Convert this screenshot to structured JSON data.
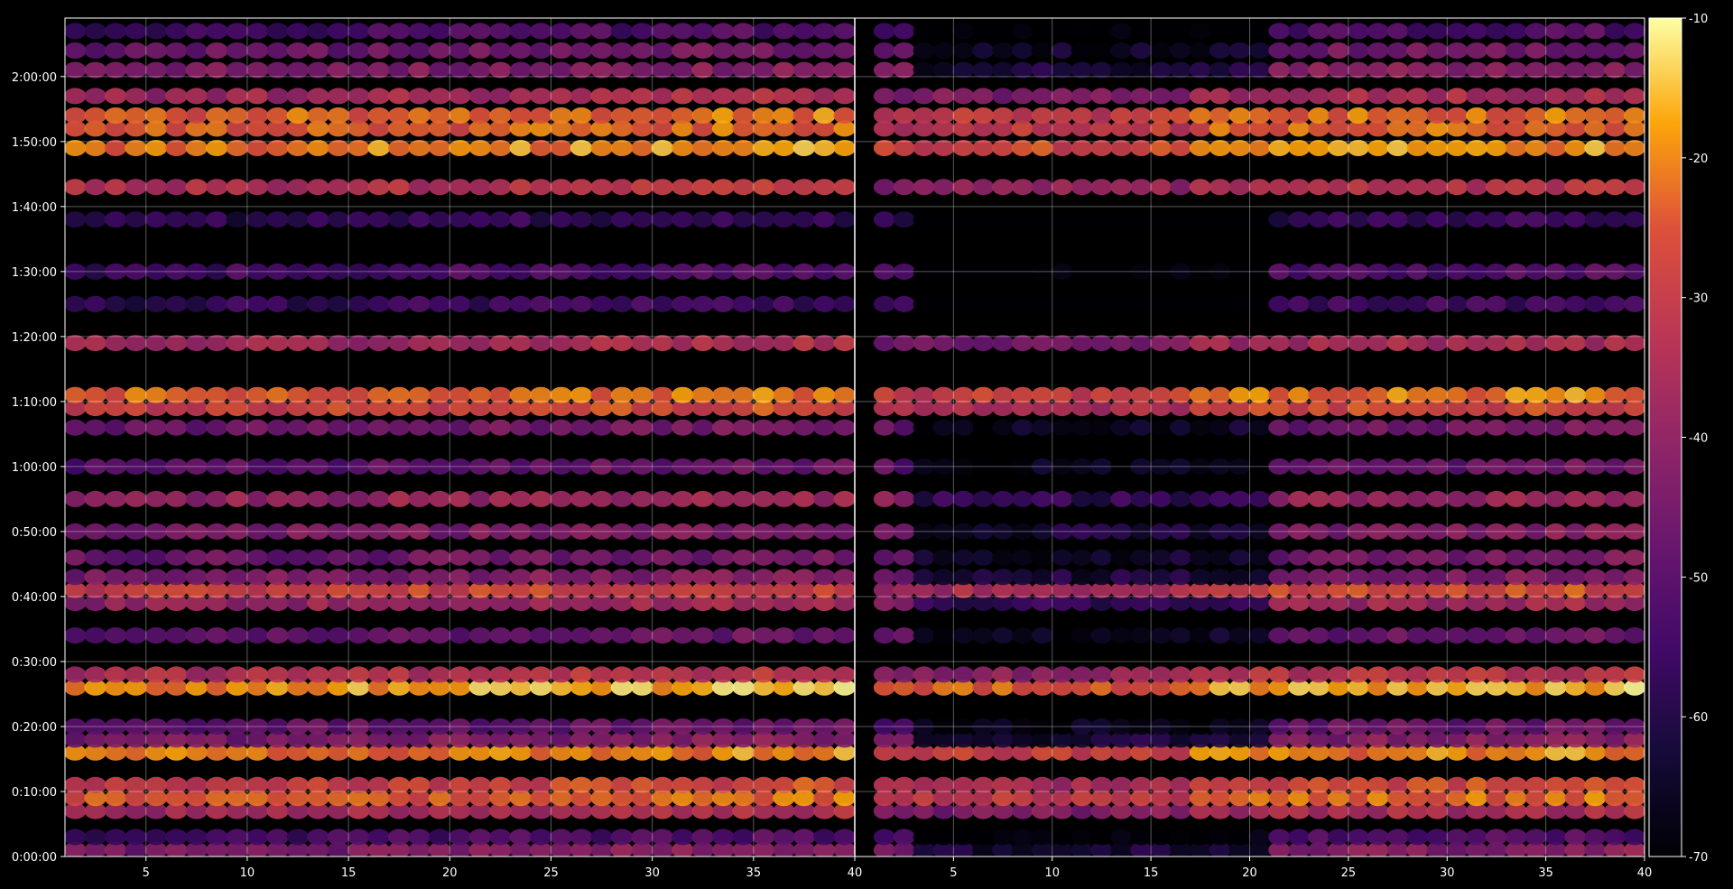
{
  "chart_data": {
    "type": "heatmap",
    "title": "",
    "xlabel": "",
    "ylabel": "",
    "panels": [
      {
        "name": "",
        "xlim": [
          1,
          40
        ]
      },
      {
        "name": "",
        "xlim": [
          0,
          40
        ]
      }
    ],
    "x_ticks": [
      "5",
      "10",
      "15",
      "20",
      "25",
      "30",
      "35",
      "40"
    ],
    "y_ticks": [
      "0:00:00",
      "0:10:00",
      "0:20:00",
      "0:30:00",
      "0:40:00",
      "0:50:00",
      "1:00:00",
      "1:10:00",
      "1:20:00",
      "1:30:00",
      "1:40:00",
      "1:50:00",
      "2:00:00"
    ],
    "ylim_seconds": [
      0,
      7740
    ],
    "grid": true,
    "colormap": "inferno",
    "colorbar": {
      "min": -70,
      "max": -10,
      "ticks": [
        "-10",
        "-20",
        "-30",
        "-40",
        "-50",
        "-60",
        "-70"
      ]
    },
    "bands": [
      {
        "t": 60,
        "level": -45
      },
      {
        "t": 180,
        "level": -55
      },
      {
        "t": 420,
        "level": -38
      },
      {
        "t": 540,
        "level": -26
      },
      {
        "t": 660,
        "level": -30
      },
      {
        "t": 960,
        "level": -23
      },
      {
        "t": 1080,
        "level": -45
      },
      {
        "t": 1200,
        "level": -50
      },
      {
        "t": 1560,
        "level": -19
      },
      {
        "t": 1680,
        "level": -35
      },
      {
        "t": 2040,
        "level": -50
      },
      {
        "t": 2340,
        "level": -40
      },
      {
        "t": 2460,
        "level": -30
      },
      {
        "t": 2580,
        "level": -45
      },
      {
        "t": 2760,
        "level": -48
      },
      {
        "t": 3000,
        "level": -45
      },
      {
        "t": 3300,
        "level": -40
      },
      {
        "t": 3600,
        "level": -50
      },
      {
        "t": 3960,
        "level": -48
      },
      {
        "t": 4140,
        "level": -30
      },
      {
        "t": 4260,
        "level": -24
      },
      {
        "t": 4740,
        "level": -38
      },
      {
        "t": 5100,
        "level": -58
      },
      {
        "t": 5400,
        "level": -55
      },
      {
        "t": 5880,
        "level": -60
      },
      {
        "t": 6180,
        "level": -35
      },
      {
        "t": 6540,
        "level": -22
      },
      {
        "t": 6720,
        "level": -26
      },
      {
        "t": 6840,
        "level": -25
      },
      {
        "t": 7020,
        "level": -38
      },
      {
        "t": 7260,
        "level": -45
      },
      {
        "t": 7440,
        "level": -48
      },
      {
        "t": 7620,
        "level": -55
      }
    ]
  }
}
